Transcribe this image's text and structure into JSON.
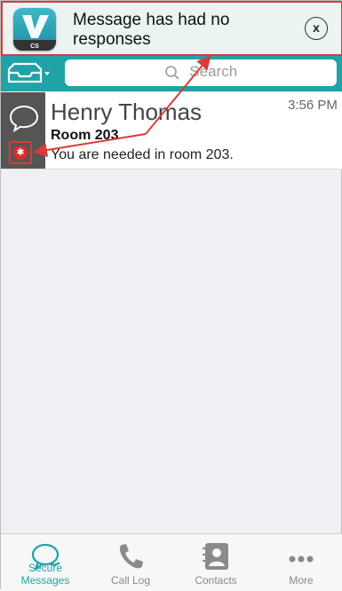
{
  "notification": {
    "app_icon": "cs-app-icon",
    "app_icon_text": "CS",
    "message": "Message has had no responses",
    "close_label": "x"
  },
  "search": {
    "placeholder": "Search"
  },
  "messages": [
    {
      "sender": "Henry Thomas",
      "time": "3:56 PM",
      "subject": "Room 203",
      "preview": "You are needed in room 203.",
      "urgent_icon": "urgent-star-icon"
    }
  ],
  "tabs": [
    {
      "label": "Secure Messages",
      "icon": "chat-bubbles-icon",
      "active": true
    },
    {
      "label": "Call Log",
      "icon": "phone-icon",
      "active": false
    },
    {
      "label": "Contacts",
      "icon": "address-book-icon",
      "active": false
    },
    {
      "label": "More",
      "icon": "more-dots-icon",
      "active": false
    }
  ],
  "colors": {
    "accent": "#1fa3a6",
    "highlight": "#d93a3a",
    "side_panel": "#555555"
  }
}
